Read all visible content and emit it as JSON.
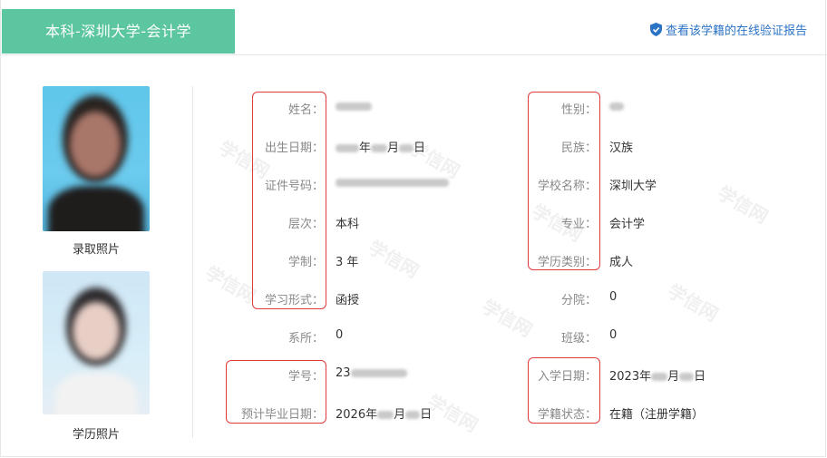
{
  "header": {
    "title": "本科-深圳大学-会计学",
    "verify_link": "查看该学籍的在线验证报告",
    "accent": "#5cc6a0",
    "link_color": "#2b73c5"
  },
  "photos": {
    "admission_caption": "录取照片",
    "degree_caption": "学历照片"
  },
  "left_fields": [
    {
      "label": "姓名：",
      "value": ""
    },
    {
      "label": "出生日期：",
      "value": "年月日"
    },
    {
      "label": "证件号码：",
      "value": ""
    },
    {
      "label": "层次：",
      "value": "本科"
    },
    {
      "label": "学制：",
      "value": "3 年"
    },
    {
      "label": "学习形式：",
      "value": "函授"
    },
    {
      "label": "系所：",
      "value": "0"
    },
    {
      "label": "学号：",
      "value": "23"
    },
    {
      "label": "预计毕业日期：",
      "value": "2026年月日"
    }
  ],
  "right_fields": [
    {
      "label": "性别：",
      "value": ""
    },
    {
      "label": "民族：",
      "value": "汉族"
    },
    {
      "label": "学校名称：",
      "value": "深圳大学"
    },
    {
      "label": "专业：",
      "value": "会计学"
    },
    {
      "label": "学历类别：",
      "value": "成人"
    },
    {
      "label": "分院：",
      "value": "0"
    },
    {
      "label": "班级：",
      "value": "0"
    },
    {
      "label": "入学日期：",
      "value": "2023年月日"
    },
    {
      "label": "学籍状态：",
      "value": "在籍（注册学籍）"
    }
  ],
  "watermark": "学信网",
  "highlight_color": "#e03a3a"
}
